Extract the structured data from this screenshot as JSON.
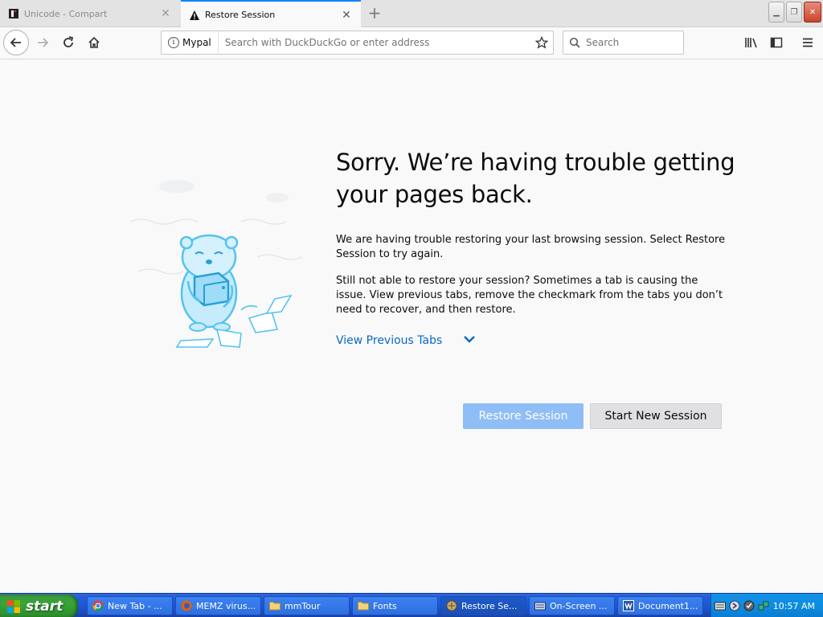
{
  "browser": {
    "tabs": [
      {
        "label": "Unicode - Compart",
        "active": false
      },
      {
        "label": "Restore Session",
        "active": true
      }
    ],
    "url_identity": "Mypal",
    "url_placeholder": "Search with DuckDuckGo or enter address",
    "search_placeholder": "Search"
  },
  "content": {
    "title": "Sorry. We’re having trouble getting your pages back.",
    "paragraph1": "We are having trouble restoring your last browsing session. Select Restore Session to try again.",
    "paragraph2": "Still not able to restore your session? Sometimes a tab is causing the issue. View previous tabs, remove the checkmark from the tabs you don’t need to recover, and then restore.",
    "view_previous_tabs": "View Previous Tabs",
    "restore_button": "Restore Session",
    "new_session_button": "Start New Session"
  },
  "taskbar": {
    "start_label": "start",
    "tasks": [
      {
        "label": "New Tab - ...",
        "icon": "chrome-icon"
      },
      {
        "label": "MEMZ virus...",
        "icon": "firefox-icon"
      },
      {
        "label": "mmTour",
        "icon": "folder-icon"
      },
      {
        "label": "Fonts",
        "icon": "folder-icon"
      },
      {
        "label": "Restore Se...",
        "icon": "browser-icon"
      },
      {
        "label": "On-Screen ...",
        "icon": "keyboard-icon"
      },
      {
        "label": "Document1...",
        "icon": "word-icon"
      }
    ],
    "clock": "10:57 AM"
  },
  "colors": {
    "accent": "#0a84ff",
    "link": "#0a68c8",
    "restore_button_bg": "#8fbdf5"
  }
}
